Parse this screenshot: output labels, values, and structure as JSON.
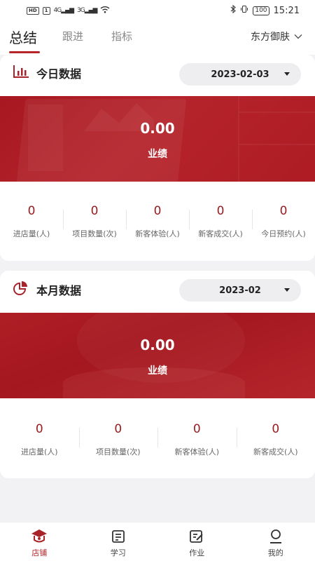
{
  "status_bar": {
    "left_badges": [
      "HD",
      "1",
      "4G",
      "3G"
    ],
    "battery": "100",
    "time": "15:21"
  },
  "tabs": [
    {
      "label": "总结",
      "active": true
    },
    {
      "label": "跟进",
      "active": false
    },
    {
      "label": "指标",
      "active": false
    }
  ],
  "store": {
    "name": "东方御肤"
  },
  "today": {
    "title": "今日数据",
    "date": "2023-02-03",
    "amount": "0.00",
    "amount_label": "业绩",
    "stats": [
      {
        "value": "0",
        "label": "进店量(人)"
      },
      {
        "value": "0",
        "label": "项目数量(次)"
      },
      {
        "value": "0",
        "label": "新客体验(人)"
      },
      {
        "value": "0",
        "label": "新客成交(人)"
      },
      {
        "value": "0",
        "label": "今日预约(人)"
      }
    ]
  },
  "month": {
    "title": "本月数据",
    "date": "2023-02",
    "amount": "0.00",
    "amount_label": "业绩",
    "stats": [
      {
        "value": "0",
        "label": "进店量(人)"
      },
      {
        "value": "0",
        "label": "项目数量(次)"
      },
      {
        "value": "0",
        "label": "新客体验(人)"
      },
      {
        "value": "0",
        "label": "新客成交(人)"
      }
    ]
  },
  "bottom_nav": [
    {
      "label": "店铺",
      "icon": "store-icon",
      "active": true
    },
    {
      "label": "学习",
      "icon": "study-icon",
      "active": false
    },
    {
      "label": "作业",
      "icon": "homework-icon",
      "active": false
    },
    {
      "label": "我的",
      "icon": "profile-icon",
      "active": false
    }
  ],
  "colors": {
    "accent": "#b5252a",
    "value": "#9a1c21",
    "background": "#f2f2f4"
  }
}
